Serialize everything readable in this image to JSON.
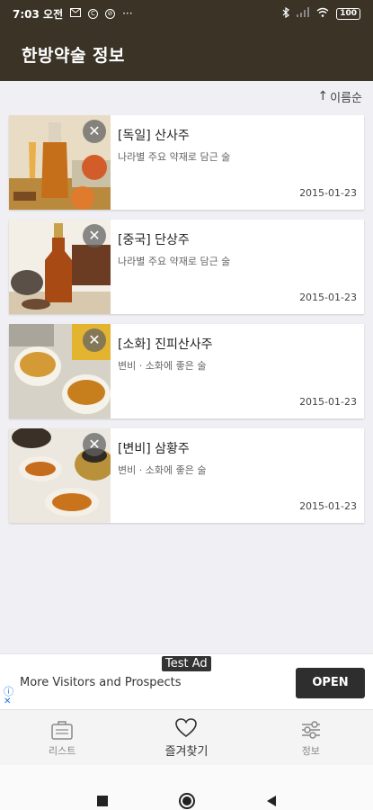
{
  "status_bar": {
    "time": "7:03 오전",
    "icons": [
      "mail-icon",
      "c-icon",
      "gesture-icon",
      "more-dots-icon"
    ],
    "battery": "100"
  },
  "app": {
    "title": "한방약술 정보"
  },
  "sort": {
    "label": "이름순",
    "arrow": "↑"
  },
  "items": [
    {
      "title": "[독일] 산사주",
      "subtitle": "나라별 주요 약재로 담근 술",
      "date": "2015-01-23",
      "image": "amber-decanter-apples"
    },
    {
      "title": "[중국] 단상주",
      "subtitle": "나라별 주요 약재로 담근 술",
      "date": "2015-01-23",
      "image": "liquor-bottle-teapot"
    },
    {
      "title": "[소화] 진피산사주",
      "subtitle": "변비 · 소화에 좋은 술",
      "date": "2015-01-23",
      "image": "tea-cups"
    },
    {
      "title": "[변비] 삼황주",
      "subtitle": "변비 · 소화에 좋은 술",
      "date": "2015-01-23",
      "image": "glass-jar-cups"
    }
  ],
  "ad": {
    "tag": "Test Ad",
    "text": "More Visitors and Prospects",
    "button": "OPEN"
  },
  "nav": {
    "items": [
      {
        "label": "리스트",
        "icon": "list-icon"
      },
      {
        "label": "즐겨찾기",
        "icon": "heart-icon"
      },
      {
        "label": "정보",
        "icon": "settings-sliders-icon"
      }
    ]
  },
  "colors": {
    "app_bar": "#3a3326",
    "background": "#f0f0f4",
    "ad_button": "#2e2e2e"
  }
}
